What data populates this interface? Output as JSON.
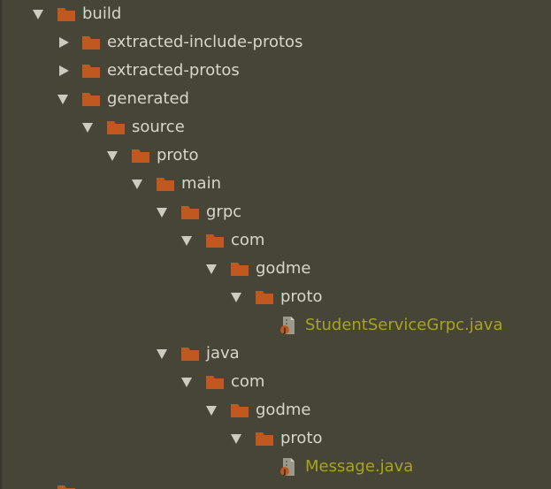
{
  "tree": {
    "build": "build",
    "extracted_include_protos": "extracted-include-protos",
    "extracted_protos": "extracted-protos",
    "generated": "generated",
    "source": "source",
    "proto": "proto",
    "main": "main",
    "grpc": "grpc",
    "grpc_com": "com",
    "grpc_godme": "godme",
    "grpc_proto": "proto",
    "grpc_file": "StudentServiceGrpc.java",
    "java": "java",
    "java_com": "com",
    "java_godme": "godme",
    "java_proto": "proto",
    "java_file": "Message.java"
  },
  "colors": {
    "background": "#474438",
    "folder": "#c0581f",
    "text": "#d8d6c9",
    "java_file_text": "#a7a51b",
    "arrow": "#cccbbf"
  },
  "icons": {
    "expanded": "triangle-down-icon",
    "collapsed": "triangle-right-icon",
    "folder": "folder-icon",
    "java_file": "java-file-icon"
  }
}
